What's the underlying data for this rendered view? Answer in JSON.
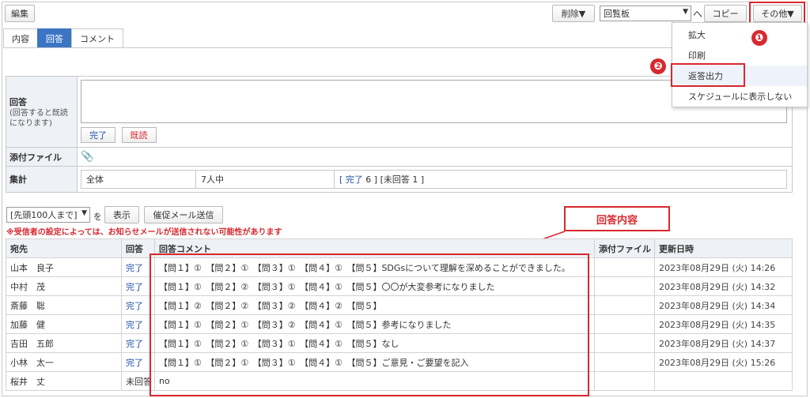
{
  "toolbar": {
    "edit_label": "編集",
    "delete_label": "削除▼",
    "board_select": "回覧板",
    "up_arrow": "ヘ",
    "copy_label": "コピー",
    "other_label": "その他▼"
  },
  "tabs": [
    {
      "label": "内容"
    },
    {
      "label": "回答"
    },
    {
      "label": "コメント"
    }
  ],
  "menu": {
    "items": [
      "拡大",
      "印刷",
      "返答出力",
      "スケジュールに表示しない"
    ]
  },
  "badges": [
    "❶",
    "❷"
  ],
  "form": {
    "answer_label": "回答",
    "answer_note": "(回答すると既読になります)",
    "done_label": "完了",
    "read_label": "既読",
    "attach_label": "添付ファイル",
    "total_label": "集計",
    "total_all": "全体",
    "total_count": "7人中",
    "total_done_open": "[",
    "total_done_text": "完了",
    "total_done_num": "6 ] [未回答 1 ]"
  },
  "filter": {
    "range_select": "[先頭100人まで]",
    "suffix": "を",
    "show_label": "表示",
    "mail_label": "催促メール送信"
  },
  "warning": "※受信者の設定によっては、お知らせメールが送信されない可能性があります",
  "callout": "回答内容",
  "list": {
    "headers": [
      "宛先",
      "回答",
      "回答コメント",
      "添付ファイル",
      "更新日時"
    ],
    "rows": [
      {
        "to": "山本　良子",
        "answer": "完了",
        "comment": "【問１】①　【問２】①　【問３】①　【問４】①　【問５】SDGsについて理解を深めることができました。",
        "attach": "",
        "date": "2023年08月29日 (火) 14:26"
      },
      {
        "to": "中村　茂",
        "answer": "完了",
        "comment": "【問１】①　【問２】②　【問３】①　【問４】①　【問５】〇〇が大変参考になりました",
        "attach": "",
        "date": "2023年08月29日 (火) 14:32"
      },
      {
        "to": "斎藤　聡",
        "answer": "完了",
        "comment": "【問１】②　【問２】②　【問３】②　【問４】②　【問５】",
        "attach": "",
        "date": "2023年08月29日 (火) 14:34"
      },
      {
        "to": "加藤　健",
        "answer": "完了",
        "comment": "【問１】①　【問２】①　【問３】②　【問４】①　【問５】参考になりました",
        "attach": "",
        "date": "2023年08月29日 (火) 14:35"
      },
      {
        "to": "吉田　五郎",
        "answer": "完了",
        "comment": "【問１】①　【問２】①　【問３】①　【問４】①　【問５】なし",
        "attach": "",
        "date": "2023年08月29日 (火) 14:37"
      },
      {
        "to": "小林　太一",
        "answer": "完了",
        "comment": "【問１】①　【問２】①　【問３】①　【問４】①　【問５】ご意見・ご要望を記入",
        "attach": "",
        "date": "2023年08月29日 (火) 15:26"
      },
      {
        "to": "桜井　丈",
        "answer": "未回答",
        "comment": "no",
        "attach": "",
        "date": ""
      }
    ]
  },
  "colors": {
    "accent": "#3b75c4",
    "highlight": "#d7282f",
    "link": "#1f4fa8"
  }
}
